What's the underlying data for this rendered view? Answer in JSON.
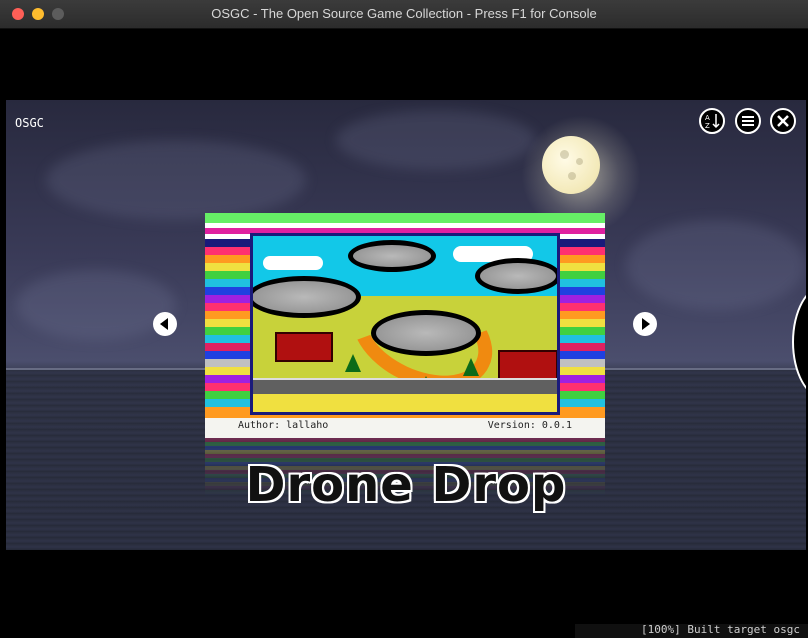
{
  "window": {
    "title": "OSGC - The Open Source Game Collection - Press F1 for Console"
  },
  "header": {
    "app_label": "OSGC"
  },
  "toolbar": {
    "sort_icon": "sort-az-icon",
    "menu_icon": "hamburger-menu-icon",
    "close_icon": "close-icon"
  },
  "game": {
    "title": "Drone Drop",
    "author": "Author: lallaho",
    "version": "Version: 0.0.1"
  },
  "nav": {
    "prev_icon": "chevron-left-icon",
    "next_icon": "chevron-right-icon"
  },
  "terminal": {
    "lines": [
      "[100%] Built target osgc"
    ]
  },
  "colors": {
    "titlebar": "#2f2f2f",
    "close_dot": "#ff5f57",
    "minimize_dot": "#febc2e",
    "zoom_dot": "#5c5c5c"
  }
}
